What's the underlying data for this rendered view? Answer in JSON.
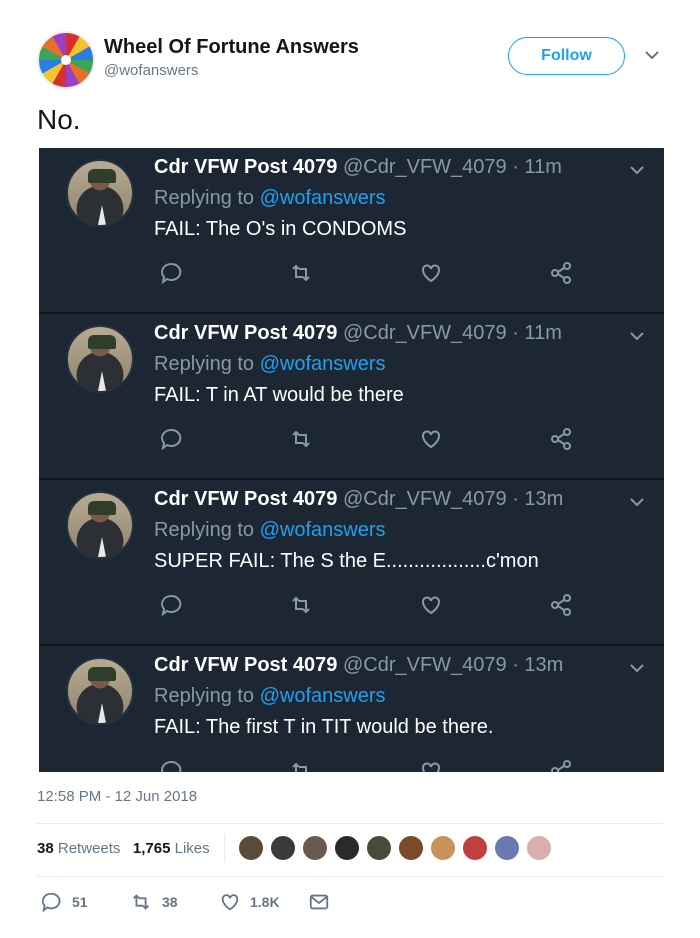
{
  "author": {
    "name": "Wheel Of Fortune Answers",
    "handle": "@wofanswers",
    "follow_label": "Follow",
    "avatar_icon": "wheel-of-fortune-icon"
  },
  "tweet": {
    "text": "No.",
    "timestamp": "12:58 PM - 12 Jun 2018"
  },
  "replies": [
    {
      "name": "Cdr VFW Post 4079",
      "handle": "@Cdr_VFW_4079",
      "time": "· 11m",
      "replying_prefix": "Replying to ",
      "replying_to": "@wofanswers",
      "text": "FAIL: The O's in CONDOMS"
    },
    {
      "name": "Cdr VFW Post 4079",
      "handle": "@Cdr_VFW_4079",
      "time": "· 11m",
      "replying_prefix": "Replying to ",
      "replying_to": "@wofanswers",
      "text": "FAIL: T in AT would be there"
    },
    {
      "name": "Cdr VFW Post 4079",
      "handle": "@Cdr_VFW_4079",
      "time": "· 13m",
      "replying_prefix": "Replying to ",
      "replying_to": "@wofanswers",
      "text": "SUPER FAIL:  The S the E..................c'mon"
    },
    {
      "name": "Cdr VFW Post 4079",
      "handle": "@Cdr_VFW_4079",
      "time": "· 13m",
      "replying_prefix": "Replying to ",
      "replying_to": "@wofanswers",
      "text": "FAIL: The first T in TIT would be there."
    }
  ],
  "stats": {
    "retweets_count": "38",
    "retweets_label": "Retweets",
    "likes_count": "1,765",
    "likes_label": "Likes"
  },
  "likers": [
    "#5a4a3a",
    "#3a3a3a",
    "#6a5a50",
    "#2a2a2a",
    "#4a4a3a",
    "#7a4a2a",
    "#c9925a",
    "#c04040",
    "#6a7ab0",
    "#d8b0b0"
  ],
  "bottom_actions": {
    "replies": "51",
    "retweets": "38",
    "likes": "1.8K"
  },
  "colors": {
    "accent": "#1da1f2",
    "panel": "#1c2733"
  }
}
